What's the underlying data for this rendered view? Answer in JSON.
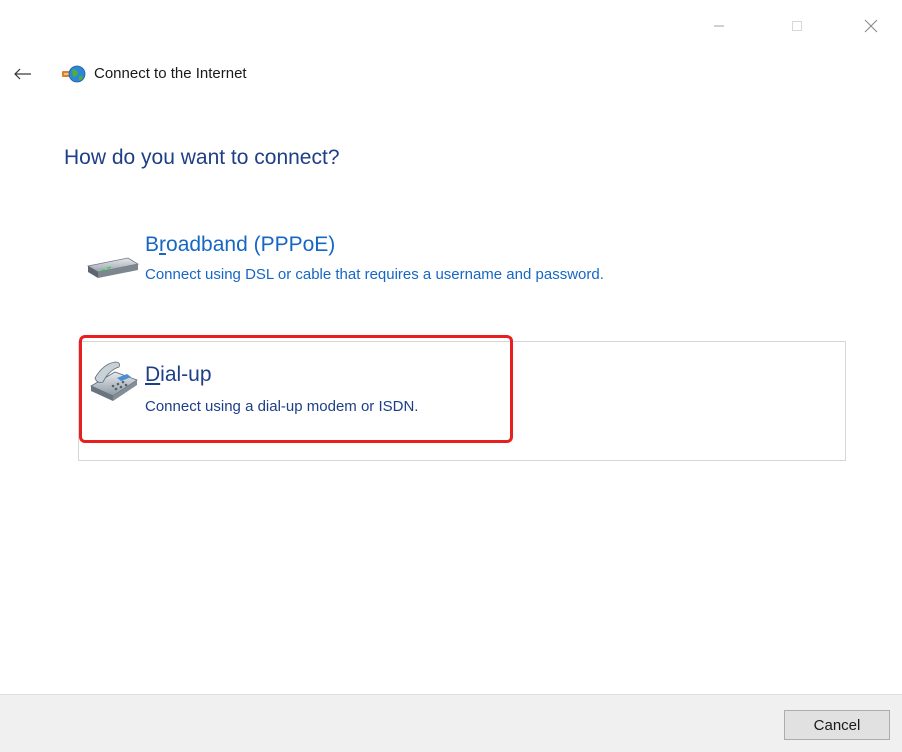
{
  "window_controls": {
    "minimize_icon": "minimize-icon",
    "maximize_icon": "maximize-icon",
    "close_icon": "close-icon"
  },
  "nav": {
    "back_icon": "back-arrow-icon",
    "app_icon": "network-globe-icon",
    "title": "Connect to the Internet"
  },
  "heading": "How do you want to connect?",
  "options": [
    {
      "title": "Broadband (PPPoE)",
      "access_key": "r",
      "description": "Connect using DSL or cable that requires a username and password.",
      "icon": "broadband-modem-icon"
    },
    {
      "title": "Dial-up",
      "access_key": "D",
      "description": "Connect using a dial-up modem or ISDN.",
      "icon": "dialup-phone-icon",
      "selected": true
    }
  ],
  "footer": {
    "cancel_label": "Cancel"
  },
  "colors": {
    "heading": "#1e3f86",
    "link": "#1667c4",
    "selected_text": "#1d3f87",
    "highlight": "#e8201d",
    "footer_bg": "#f0f0f0"
  }
}
